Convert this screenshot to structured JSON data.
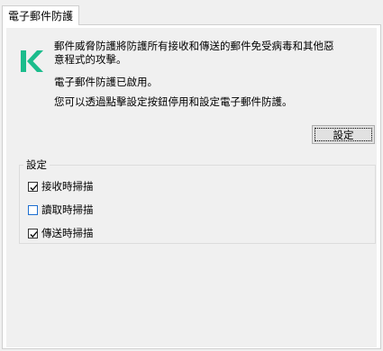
{
  "tab": {
    "title": "電子郵件防護"
  },
  "description": {
    "line1": "郵件威脅防護將防護所有接收和傳送的郵件免受病毒和其他惡意程式的攻擊。",
    "status": "電子郵件防護已啟用。",
    "hint": "您可以透過點擊設定按鈕停用和設定電子郵件防護。"
  },
  "settings_button": {
    "label": "設定"
  },
  "settings_group": {
    "title": "設定",
    "options": [
      {
        "label": "接收時掃描",
        "checked": true
      },
      {
        "label": "讀取時掃描",
        "checked": false
      },
      {
        "label": "傳送時掃描",
        "checked": true
      }
    ]
  },
  "colors": {
    "logo": "#1bbc8c",
    "checkbox_focus": "#1e6fd0"
  },
  "icons": {
    "logo": "kaspersky-k-icon",
    "check": "checkmark-icon"
  }
}
